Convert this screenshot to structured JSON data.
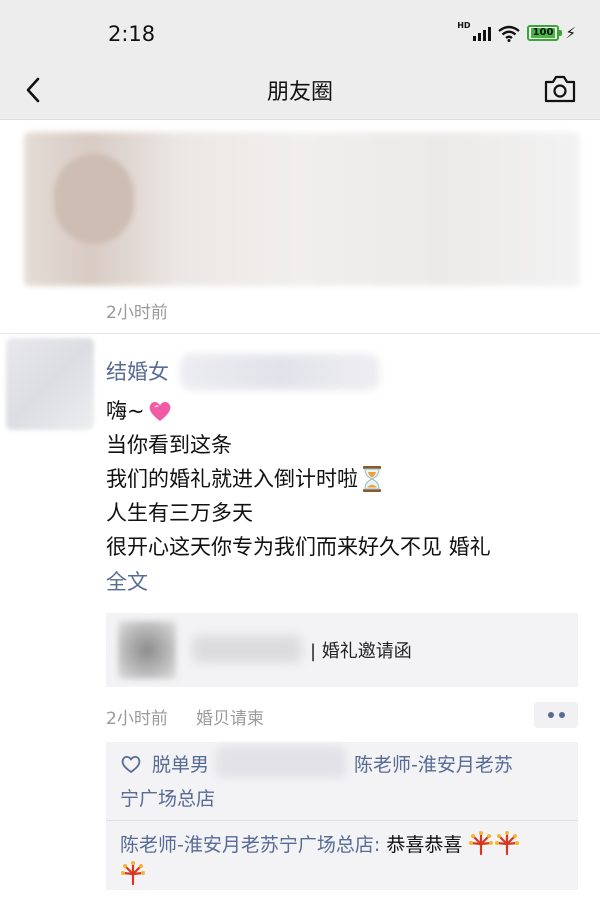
{
  "status_bar": {
    "time": "2:18",
    "signal_label": "HD",
    "battery": "100"
  },
  "nav": {
    "title": "朋友圈",
    "back_icon": "back-arrow-icon",
    "camera_icon": "camera-icon"
  },
  "post1": {
    "time": "2小时前"
  },
  "post2": {
    "author": "结婚女",
    "lines": [
      "嗨~",
      "当你看到这条",
      "我们的婚礼就进入倒计时啦",
      "人生有三万多天",
      "很开心这天你专为我们而来好久不见 婚礼"
    ],
    "full_text": "全文",
    "share_title": "| 婚礼邀请函",
    "time": "2小时前",
    "source": "婚贝请柬",
    "likes_prefix": "脱单男",
    "likes_mid": "陈老师-淮安月老苏",
    "likes_end": "宁广场总店",
    "comment_author": "陈老师-淮安月老苏宁广场总店:",
    "comment_text": "恭喜恭喜"
  },
  "colors": {
    "link": "#576b95",
    "bar_bg": "#ededed",
    "card_bg": "#f3f3f5",
    "meta": "#9a9a9a",
    "battery": "#49b545"
  }
}
